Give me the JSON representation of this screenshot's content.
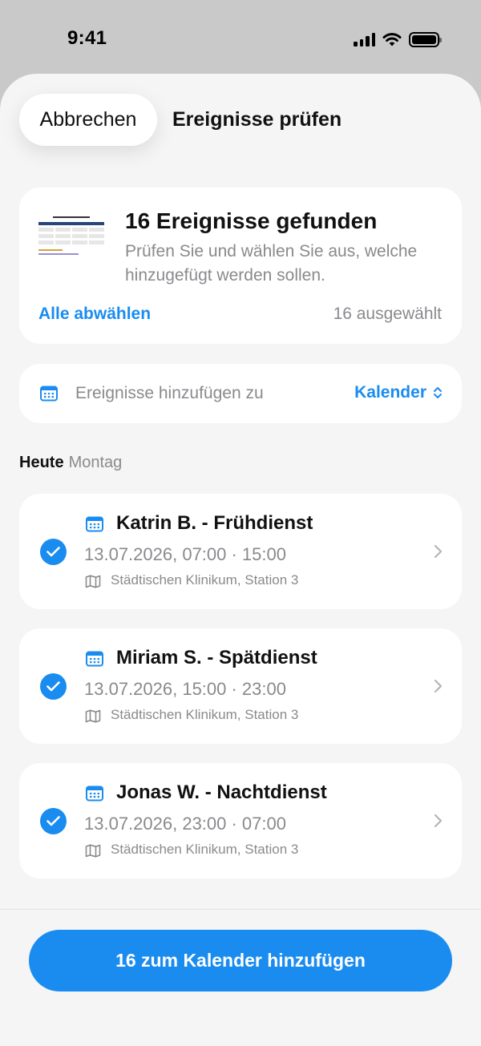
{
  "status_bar": {
    "time": "9:41"
  },
  "header": {
    "cancel_label": "Abbrechen",
    "title": "Ereignisse prüfen"
  },
  "summary": {
    "title": "16 Ereignisse gefunden",
    "subtitle": "Prüfen Sie und wählen Sie aus, welche hinzugefügt werden sollen.",
    "deselect_label": "Alle abwählen",
    "selected_count": "16 ausgewählt"
  },
  "target": {
    "label": "Ereignisse hinzufügen zu",
    "value": "Kalender"
  },
  "day": {
    "today": "Heute",
    "weekday": "Montag"
  },
  "events": [
    {
      "title": "Katrin B. - Frühdienst",
      "time": "13.07.2026, 07:00 · 15:00",
      "location": "Städtischen Klinikum, Station 3",
      "checked": true
    },
    {
      "title": "Miriam S. - Spätdienst",
      "time": "13.07.2026, 15:00 · 23:00",
      "location": "Städtischen Klinikum, Station 3",
      "checked": true
    },
    {
      "title": "Jonas W. - Nachtdienst",
      "time": "13.07.2026, 23:00 · 07:00",
      "location": "Städtischen Klinikum, Station 3",
      "checked": true
    }
  ],
  "primary_button": {
    "label": "16 zum Kalender hinzufügen"
  },
  "colors": {
    "accent": "#1a8cf0",
    "background": "#f5f5f5",
    "card": "#ffffff",
    "secondary_text": "#8a8a8e"
  }
}
